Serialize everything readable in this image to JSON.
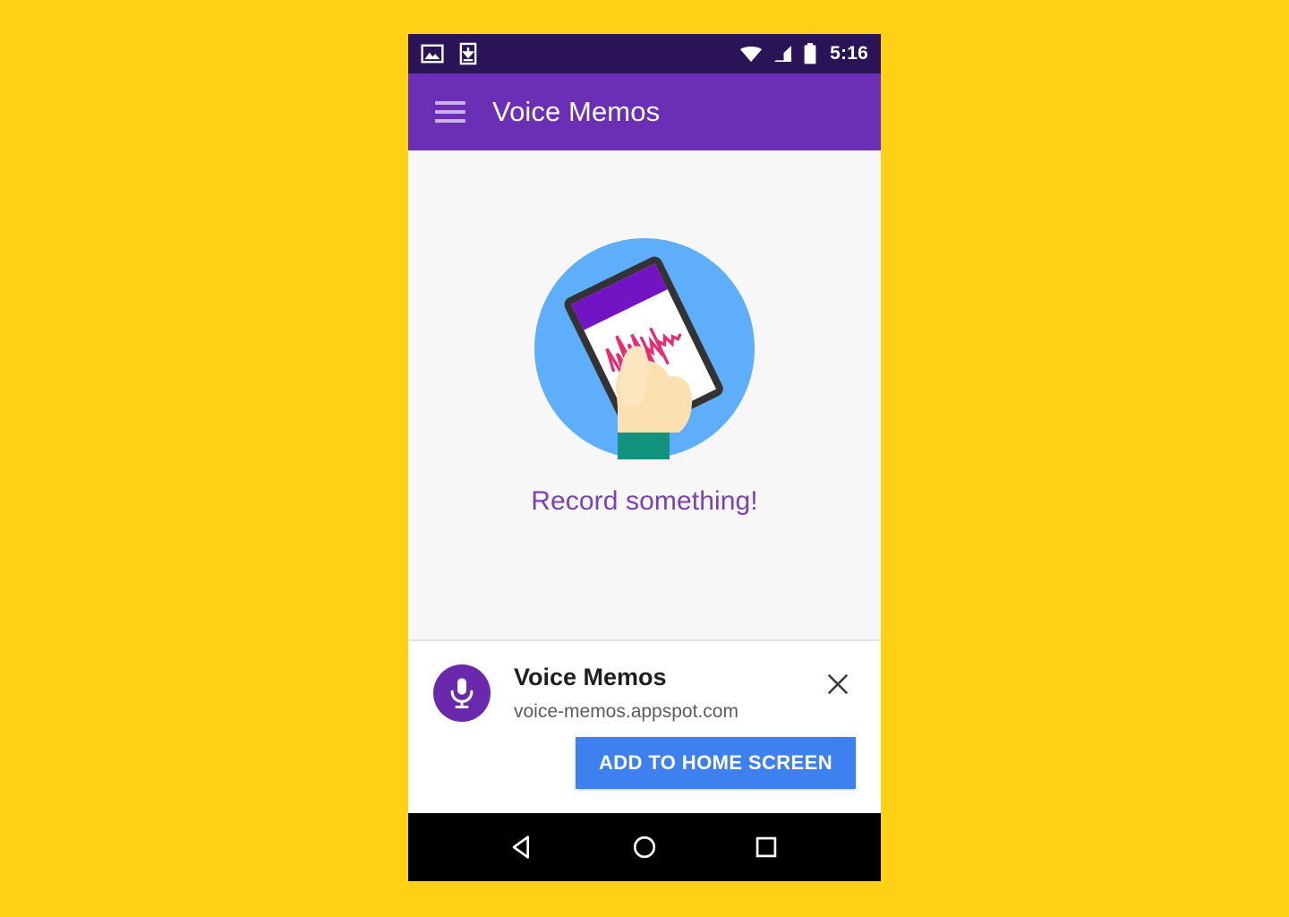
{
  "page": {
    "background_color": "#FFD116"
  },
  "status_bar": {
    "background_color": "#2B1358",
    "time": "5:16",
    "left_icons": [
      {
        "name": "image-icon",
        "label": "Screenshot captured"
      },
      {
        "name": "download-icon",
        "label": "Download complete"
      }
    ],
    "right_icons": [
      {
        "name": "wifi-icon",
        "label": "Wi-Fi"
      },
      {
        "name": "cellular-signal-icon",
        "label": "Mobile signal"
      },
      {
        "name": "battery-icon",
        "label": "Battery"
      }
    ]
  },
  "app_bar": {
    "background_color": "#6A2FB5",
    "menu_icon": "hamburger-menu-icon",
    "title": "Voice Memos"
  },
  "content": {
    "background_color": "#F7F7F7",
    "empty_state": {
      "illustration": "hand-holding-phone-illustration",
      "circle_color": "#5FAEFB",
      "phone_bezel_color": "#333333",
      "phone_header_color": "#7214C4",
      "waveform_color": "#E52D72",
      "skin_color": "#FBE0B2",
      "sleeve_color": "#12937E",
      "message": "Record something!",
      "message_color": "#7B3FB8"
    }
  },
  "install_banner": {
    "app_icon": "microphone-icon",
    "app_icon_background": "#6A28AD",
    "title": "Voice Memos",
    "url": "voice-memos.appspot.com",
    "close_icon": "close-icon",
    "add_button_label": "ADD TO HOME SCREEN",
    "add_button_color": "#3F80F0"
  },
  "nav_bar": {
    "background_color": "#000000",
    "buttons": [
      {
        "name": "back-button",
        "icon": "back-triangle-icon"
      },
      {
        "name": "home-button",
        "icon": "home-circle-icon"
      },
      {
        "name": "recents-button",
        "icon": "recents-square-icon"
      }
    ]
  }
}
